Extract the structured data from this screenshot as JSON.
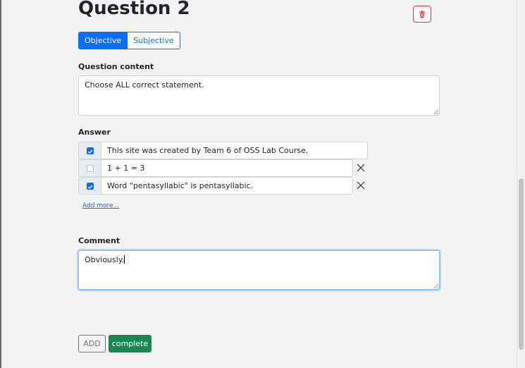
{
  "question": {
    "title": "Question 2"
  },
  "type_toggle": {
    "objective_label": "Objective",
    "subjective_label": "Subjective",
    "selected": "Objective"
  },
  "content": {
    "label": "Question content",
    "value": "Choose ALL correct statement."
  },
  "answers": {
    "label": "Answer",
    "items": [
      {
        "text": "This site was created by Team 6 of OSS Lab Course.",
        "checked": true
      },
      {
        "text": "1 + 1 = 3",
        "checked": false
      },
      {
        "text": "Word \"pentasyllabic\" is pentasyllabic.",
        "checked": true
      }
    ],
    "add_more_label": "Add more..."
  },
  "comment": {
    "label": "Comment",
    "value": "Obviously."
  },
  "buttons": {
    "add_label": "ADD",
    "complete_label": "complete"
  },
  "colors": {
    "primary": "#0d6efd",
    "danger": "#dc3545",
    "success": "#198754",
    "secondary": "#6c757d"
  },
  "icons": {
    "delete": "trash-icon",
    "remove": "close-icon",
    "check": "checkmark-icon"
  }
}
